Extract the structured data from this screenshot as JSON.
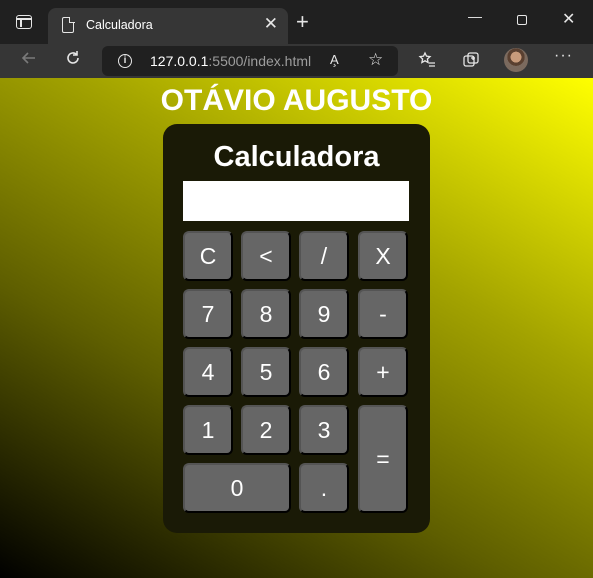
{
  "browser": {
    "tab_title": "Calculadora",
    "tab_close": "✕",
    "new_tab": "+",
    "minimize": "—",
    "close": "✕",
    "url_host": "127.0.0.1",
    "url_rest": ":5500/index.html",
    "read_aloud_label": "A̧",
    "more_label": "···"
  },
  "page": {
    "heading": "OTÁVIO AUGUSTO"
  },
  "calculator": {
    "title": "Calculadora",
    "display_value": "",
    "keys": {
      "clear": "C",
      "backspace": "<",
      "divide": "/",
      "multiply": "X",
      "seven": "7",
      "eight": "8",
      "nine": "9",
      "minus": "-",
      "four": "4",
      "five": "5",
      "six": "6",
      "plus": "+",
      "one": "1",
      "two": "2",
      "three": "3",
      "equals": "=",
      "zero": "0",
      "dot": "."
    }
  },
  "colors": {
    "background_gradient_start": "#000000",
    "background_gradient_end": "#ffff00",
    "calculator_body": "#1a1a06",
    "key": "#666666"
  }
}
